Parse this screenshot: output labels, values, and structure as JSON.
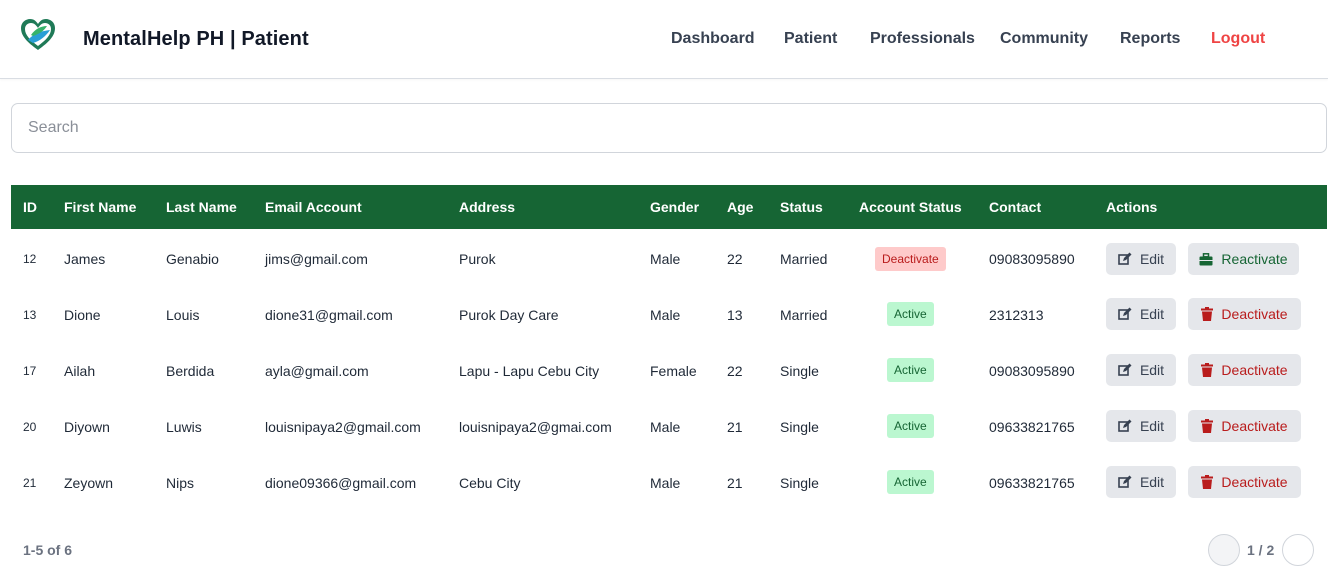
{
  "app": {
    "title": "MentalHelp PH | Patient"
  },
  "nav": {
    "items": [
      {
        "label": "Dashboard"
      },
      {
        "label": "Patient"
      },
      {
        "label": "Professionals"
      },
      {
        "label": "Community"
      },
      {
        "label": "Reports"
      }
    ],
    "logout_label": "Logout"
  },
  "search": {
    "placeholder": "Search",
    "value": ""
  },
  "table": {
    "columns": [
      "ID",
      "First Name",
      "Last Name",
      "Email Account",
      "Address",
      "Gender",
      "Age",
      "Status",
      "Account Status",
      "Contact",
      "Actions"
    ],
    "rows": [
      {
        "id": "12",
        "first": "James",
        "last": "Genabio",
        "email": "jims@gmail.com",
        "address": "Purok",
        "gender": "Male",
        "age": "22",
        "status": "Married",
        "account_status": "Deactivate",
        "contact": "09083095890",
        "edit_label": "Edit",
        "toggle_label": "Reactivate"
      },
      {
        "id": "13",
        "first": "Dione",
        "last": "Louis",
        "email": "dione31@gmail.com",
        "address": "Purok Day Care",
        "gender": "Male",
        "age": "13",
        "status": "Married",
        "account_status": "Active",
        "contact": "2312313",
        "edit_label": "Edit",
        "toggle_label": "Deactivate"
      },
      {
        "id": "17",
        "first": "Ailah",
        "last": "Berdida",
        "email": "ayla@gmail.com",
        "address": "Lapu - Lapu Cebu City",
        "gender": "Female",
        "age": "22",
        "status": "Single",
        "account_status": "Active",
        "contact": "09083095890",
        "edit_label": "Edit",
        "toggle_label": "Deactivate"
      },
      {
        "id": "20",
        "first": "Diyown",
        "last": "Luwis",
        "email": "louisnipaya2@gmail.com",
        "address": "louisnipaya2@gmai.com",
        "gender": "Male",
        "age": "21",
        "status": "Single",
        "account_status": "Active",
        "contact": "09633821765",
        "edit_label": "Edit",
        "toggle_label": "Deactivate"
      },
      {
        "id": "21",
        "first": "Zeyown",
        "last": "Nips",
        "email": "dione09366@gmail.com",
        "address": "Cebu City",
        "gender": "Male",
        "age": "21",
        "status": "Single",
        "account_status": "Active",
        "contact": "09633821765",
        "edit_label": "Edit",
        "toggle_label": "Deactivate"
      }
    ]
  },
  "pagination": {
    "range_text": "1-5 of 6",
    "page_text": "1 / 2"
  },
  "colors": {
    "header_bg": "#166534",
    "logout": "#ef4444",
    "active_badge_bg": "#bbf7d0",
    "deactivate_badge_bg": "#fecaca"
  },
  "icons": {
    "logo": "heart-leaf-logo",
    "edit": "edit-icon",
    "deactivate": "trash-icon",
    "reactivate": "briefcase-icon"
  }
}
